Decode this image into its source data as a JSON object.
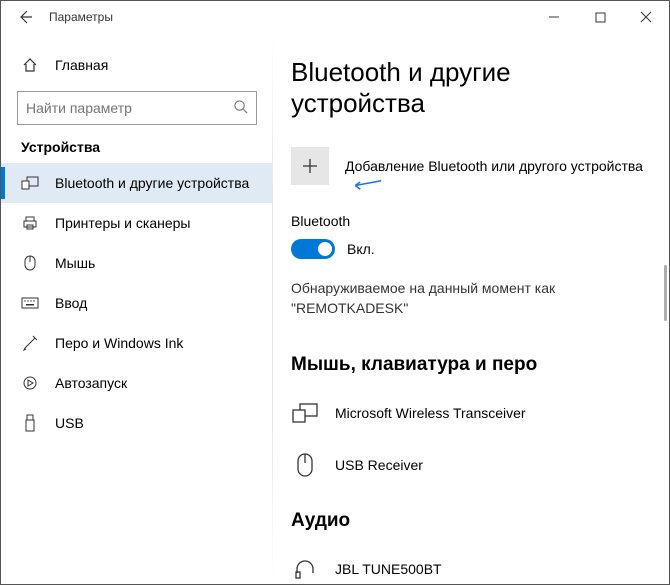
{
  "titlebar": {
    "title": "Параметры"
  },
  "sidebar": {
    "home": "Главная",
    "search_placeholder": "Найти параметр",
    "category": "Устройства",
    "items": [
      {
        "label": "Bluetooth и другие устройства"
      },
      {
        "label": "Принтеры и сканеры"
      },
      {
        "label": "Мышь"
      },
      {
        "label": "Ввод"
      },
      {
        "label": "Перо и Windows Ink"
      },
      {
        "label": "Автозапуск"
      },
      {
        "label": "USB"
      }
    ]
  },
  "main": {
    "title": "Bluetooth и другие устройства",
    "add_device_label": "Добавление Bluetooth или другого устройства",
    "bt_section_label": "Bluetooth",
    "bt_toggle_state": "Вкл.",
    "discoverable_line1": "Обнаруживаемое на данный момент как",
    "discoverable_line2": "\"REMOTKADESK\"",
    "mouse_section": "Мышь, клавиатура и перо",
    "devices": [
      {
        "name": "Microsoft Wireless Transceiver"
      },
      {
        "name": "USB Receiver"
      }
    ],
    "audio_section": "Аудио",
    "audio_devices": [
      {
        "name": "JBL TUNE500BT"
      }
    ]
  }
}
